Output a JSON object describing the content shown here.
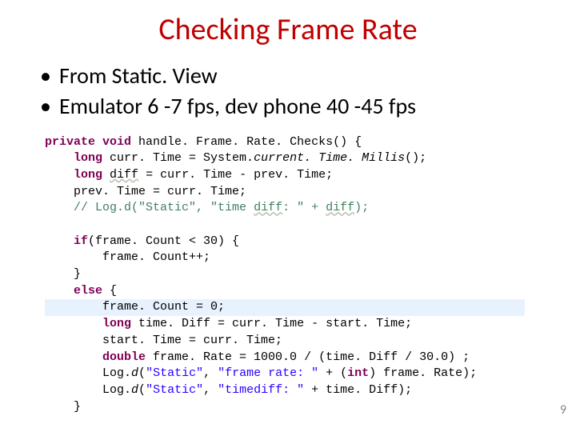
{
  "title": "Checking Frame Rate",
  "bullets": [
    "From Static. View",
    "Emulator 6 -7 fps, dev phone 40 -45 fps"
  ],
  "code": {
    "l1a": "private",
    "l1b": "void",
    "l1c": " handle. Frame. Rate. Checks() {",
    "l2a": "long",
    "l2b": " curr. Time = System.",
    "l2c": "current. Time. Millis",
    "l2d": "();",
    "l3a": "long",
    "l3b": " ",
    "l3c": "diff",
    "l3d": " = curr. Time - prev. Time;",
    "l4": "prev. Time = curr. Time;",
    "l5a": "// Log.d(\"Static\", \"time ",
    "l5b": "diff",
    "l5c": ": \" + ",
    "l5d": "diff",
    "l5e": ");",
    "l6a": "if",
    "l6b": "(frame. Count < 30) {",
    "l7": "frame. Count++;",
    "l8": "}",
    "l9a": "else",
    "l9b": " {",
    "l10": "frame. Count = 0;",
    "l11a": "long",
    "l11b": " time. Diff = curr. Time - start. Time;",
    "l12": "start. Time = curr. Time;",
    "l13a": "double",
    "l13b": " frame. Rate = 1000.0 / (time. Diff / 30.0) ;",
    "l14a": "Log.",
    "l14b": "d",
    "l14c": "(",
    "l14d": "\"Static\"",
    "l14e": ", ",
    "l14f": "\"frame rate: \"",
    "l14g": " + (",
    "l14h": "int",
    "l14i": ") frame. Rate);",
    "l15a": "Log.",
    "l15b": "d",
    "l15c": "(",
    "l15d": "\"Static\"",
    "l15e": ", ",
    "l15f": "\"timediff: \"",
    "l15g": " + time. Diff);",
    "l16": "}"
  },
  "pagenum": "9"
}
